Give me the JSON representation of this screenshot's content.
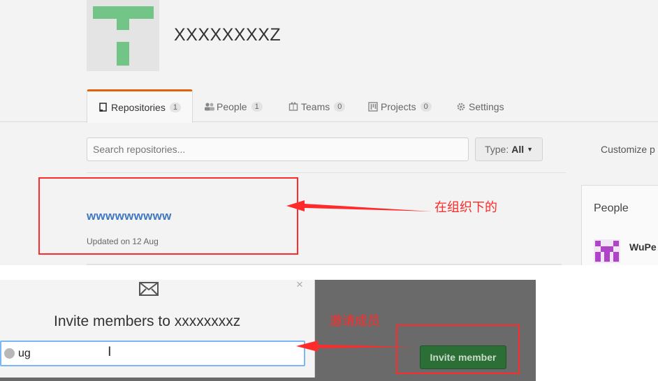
{
  "org": {
    "name": "XXXXXXXXZ"
  },
  "tabs": [
    {
      "label": "Repositories",
      "count": "1",
      "icon": "repo-icon"
    },
    {
      "label": "People",
      "count": "1",
      "icon": "people-icon"
    },
    {
      "label": "Teams",
      "count": "0",
      "icon": "teams-icon"
    },
    {
      "label": "Projects",
      "count": "0",
      "icon": "projects-icon"
    },
    {
      "label": "Settings",
      "icon": "gear-icon"
    }
  ],
  "search": {
    "placeholder": "Search repositories..."
  },
  "type_filter": {
    "label": "Type:",
    "value": "All"
  },
  "customize": {
    "label": "Customize p"
  },
  "repo": {
    "name": "wwwwwwwww",
    "updated": "Updated on 12 Aug"
  },
  "people": {
    "title": "People",
    "first_member": "WuPe"
  },
  "annotations": {
    "repo_note": "在组织下的",
    "invite_note": "邀请成员",
    "color": "#ff2a2a"
  },
  "invite_dialog": {
    "title": "Invite members to xxxxxxxxz",
    "close": "×",
    "input_value": "ug",
    "button_label": "Invite member"
  },
  "colors": {
    "accent_tab": "#e36209",
    "link": "#4078c0",
    "avatar_green": "#72c487",
    "button_green": "#2b6e36"
  }
}
